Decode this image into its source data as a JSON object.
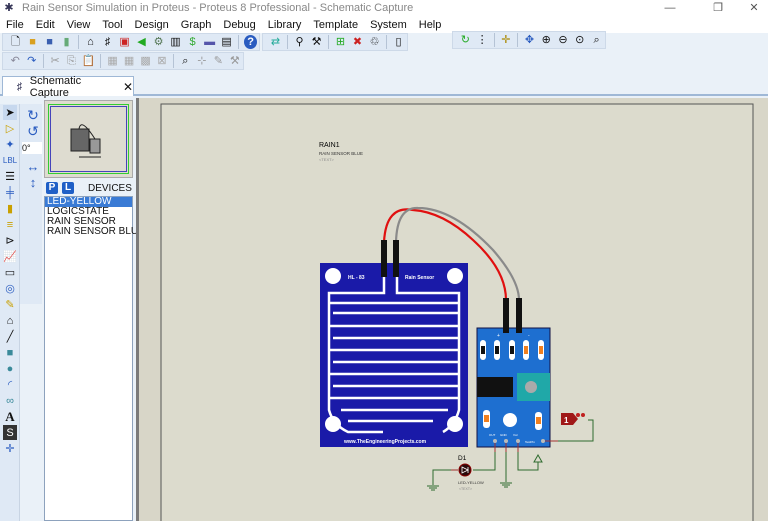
{
  "window": {
    "title": "Rain Sensor Simulation in Proteus - Proteus 8 Professional - Schematic Capture",
    "minimize": "—",
    "maximize": "❐",
    "close": "✕"
  },
  "menu": [
    "File",
    "Edit",
    "View",
    "Tool",
    "Design",
    "Graph",
    "Debug",
    "Library",
    "Template",
    "System",
    "Help"
  ],
  "tab": {
    "label": "Schematic Capture",
    "close": "✕"
  },
  "rotation": {
    "angle": "0°"
  },
  "devices": {
    "p_button": "P",
    "l_button": "L",
    "title": "DEVICES",
    "items": [
      "LED-YELLOW",
      "LOGICSTATE",
      "RAIN SENSOR",
      "RAIN SENSOR BLUE"
    ],
    "selected": 0
  },
  "schematic": {
    "rain_ref": "RAIN1",
    "rain_value": "RAIN SENSOR BLUE",
    "rain_text": "<TEXT>",
    "board_left_label": "HL - 83",
    "board_right_label": "Rain Sensor",
    "board_url": "www.TheEngineeringProjects.com",
    "module_plus": "+",
    "module_minus": "-",
    "pins": [
      "OUT",
      "GND",
      "Vcc",
      "TestPin"
    ],
    "led_ref": "D1",
    "led_value": "LED-YELLOW",
    "led_text": "<TEXT>",
    "logic_state": "1",
    "colors": {
      "board": "#1a1aa8",
      "module": "#1e6fd0",
      "wire_red": "#e01010",
      "wire_gray": "#8a8a8a",
      "net": "#2e6b2e",
      "sheet": "#dcdbcd"
    }
  }
}
